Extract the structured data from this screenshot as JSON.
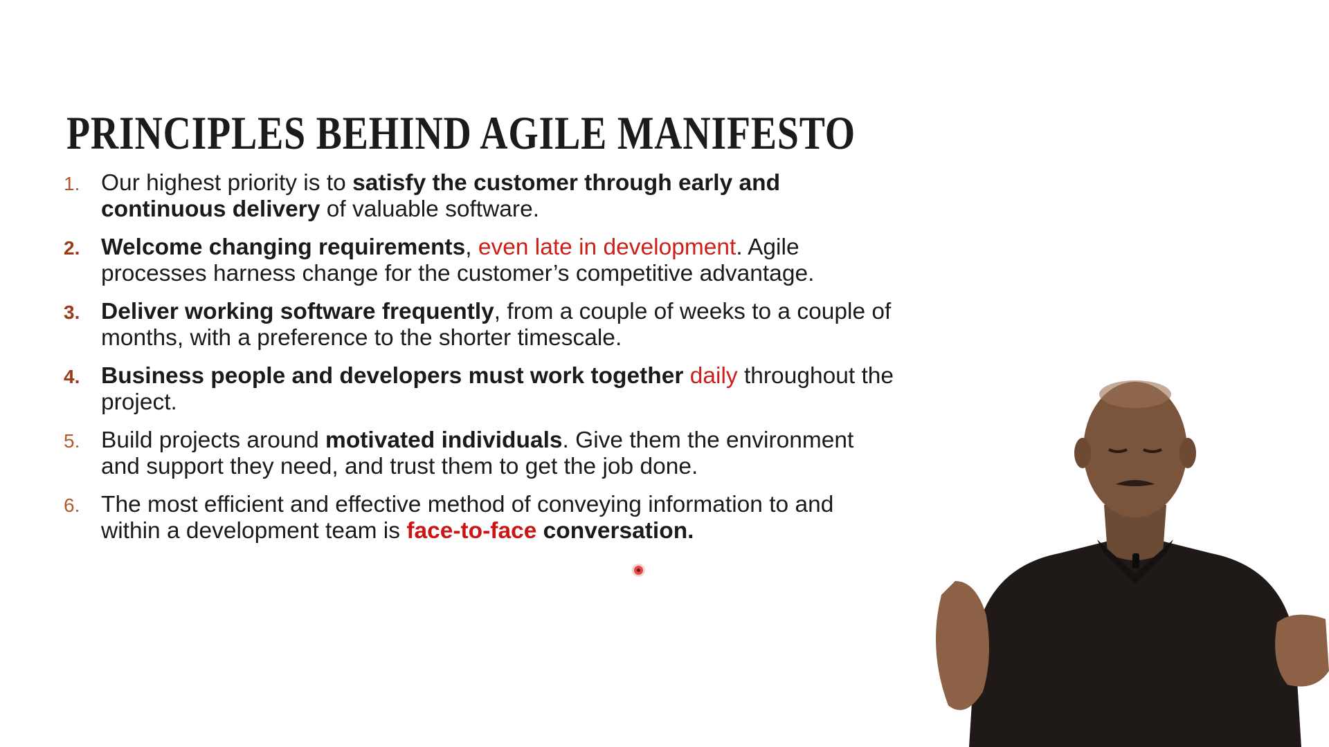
{
  "slide": {
    "title": "PRINCIPLES BEHIND AGILE MANIFESTO",
    "principles": [
      {
        "number": "1.",
        "segments": [
          {
            "text": "Our highest priority is to "
          },
          {
            "text": "satisfy the customer through early and continuous delivery"
          },
          {
            "text": " of valuable software."
          }
        ]
      },
      {
        "number": "2.",
        "segments": [
          {
            "text": "Welcome changing requirements"
          },
          {
            "text": ", "
          },
          {
            "text": "even late in development"
          },
          {
            "text": ". Agile processes harness change for the customer’s competitive advantage."
          }
        ]
      },
      {
        "number": "3.",
        "segments": [
          {
            "text": "Deliver working software frequently"
          },
          {
            "text": ", from a couple of weeks to a couple of months, with a preference to the shorter timescale."
          }
        ]
      },
      {
        "number": "4.",
        "segments": [
          {
            "text": "Business people and developers must work together"
          },
          {
            "text": " "
          },
          {
            "text": "daily"
          },
          {
            "text": " throughout the project."
          }
        ]
      },
      {
        "number": "5.",
        "segments": [
          {
            "text": "Build projects around "
          },
          {
            "text": "motivated individuals"
          },
          {
            "text": ". Give them the environment and support they need, and trust them to get the job done."
          }
        ]
      },
      {
        "number": "6.",
        "segments": [
          {
            "text": "The most efficient and effective method of conveying information to and within a development team is "
          },
          {
            "text": "face-to-face"
          },
          {
            "text": " "
          },
          {
            "text": "conversation."
          }
        ]
      }
    ]
  },
  "colors": {
    "highlight_red": "#cc1f1a",
    "number_brown": "#9a3a16",
    "body_text": "#1a1a1a",
    "laser_pointer": "#e14a46"
  },
  "icons": {
    "laser_pointer": "laser-pointer-icon"
  }
}
